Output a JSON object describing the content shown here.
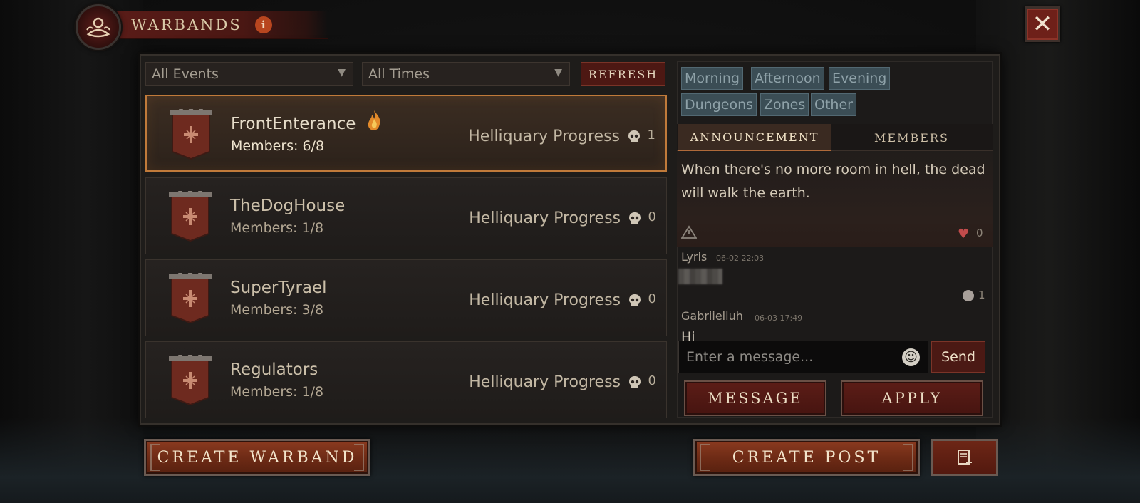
{
  "header": {
    "title": "WARBANDS",
    "info_glyph": "i",
    "close_glyph": "✕"
  },
  "filters": {
    "events": "All Events",
    "times": "All Times",
    "refresh": "REFRESH"
  },
  "warbands": [
    {
      "name": "FrontEnterance",
      "members": "Members: 6/8",
      "progress_label": "Helliquary Progress",
      "progress_count": "1",
      "selected": true,
      "hot": true
    },
    {
      "name": "TheDogHouse",
      "members": "Members: 1/8",
      "progress_label": "Helliquary Progress",
      "progress_count": "0"
    },
    {
      "name": "SuperTyrael",
      "members": "Members: 3/8",
      "progress_label": "Helliquary Progress",
      "progress_count": "0"
    },
    {
      "name": "Regulators",
      "members": "Members: 1/8",
      "progress_label": "Helliquary Progress",
      "progress_count": "0"
    }
  ],
  "tags": [
    "Morning",
    "Afternoon",
    "Evening",
    "Dungeons",
    "Zones",
    "Other"
  ],
  "tabs": {
    "announcement": "ANNOUNCEMENT",
    "members": "MEMBERS"
  },
  "announcement": {
    "text": "When there's no more room in hell, the dead will walk the earth.",
    "likes": "0"
  },
  "comments": [
    {
      "author": "Lyris",
      "time": "06-02 22:03",
      "reactions": "1"
    },
    {
      "author": "Gabriielluh",
      "time": "06-03 17:49",
      "text": "Hi"
    }
  ],
  "message": {
    "placeholder": "Enter a message...",
    "send": "Send"
  },
  "actions": {
    "message": "MESSAGE",
    "apply": "APPLY"
  },
  "bottom": {
    "create_warband": "CREATE WARBAND",
    "create_post": "CREATE POST"
  },
  "colors": {
    "accent_orange": "#c07a3a",
    "button_red": "#5c1d17",
    "tag_slate": "#3b4d55"
  }
}
